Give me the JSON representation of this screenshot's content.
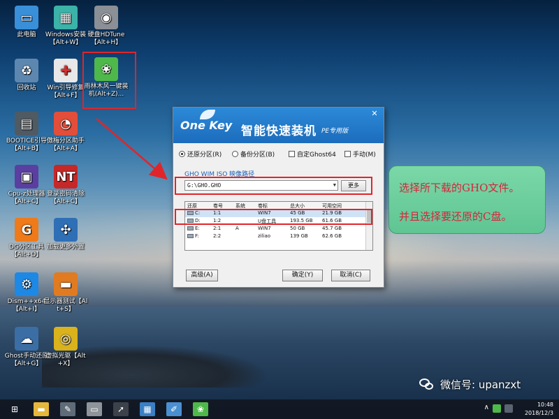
{
  "desktop_icons": [
    {
      "id": "this-pc",
      "label": "此电脑",
      "icon": "computer-icon",
      "color": "#3a8fd9",
      "glyph": "▭"
    },
    {
      "id": "windows-install",
      "label": "Windows安装【Alt+W】",
      "icon": "windows-install-icon",
      "color": "#3bb3a8",
      "glyph": "▦"
    },
    {
      "id": "hdtune",
      "label": "硬盘HDTune【Alt+H】",
      "icon": "hdd-icon",
      "color": "#8b8f96",
      "glyph": "◉"
    },
    {
      "id": "recycle-bin",
      "label": "回收站",
      "icon": "recycle-bin-icon",
      "color": "#5e87b0",
      "glyph": "♻"
    },
    {
      "id": "win-boot-repair",
      "label": "Win引导修复【Alt+F】",
      "icon": "first-aid-kit-icon",
      "color": "#e8e8e8",
      "glyph": "✚"
    },
    {
      "id": "ylmf-onekey",
      "label": "雨林木风一键装机(Alt+Z)...",
      "icon": "ghost-leaf-icon",
      "color": "#4fb84a",
      "glyph": "❀"
    },
    {
      "id": "bootice",
      "label": "BOOTICE引导【Alt+B】",
      "icon": "floppy-icon",
      "color": "#505a63",
      "glyph": "▤"
    },
    {
      "id": "partition-assistant",
      "label": "傲梅分区助手【Alt+A】",
      "icon": "pie-disk-icon",
      "color": "#e24e3a",
      "glyph": "◔"
    },
    {
      "id": "cpu-z",
      "label": "Cpu-z处理器【Alt+C】",
      "icon": "cpu-chip-icon",
      "color": "#5a3fa0",
      "glyph": "▣"
    },
    {
      "id": "password-clear",
      "label": "登录密码清除【Alt+C】",
      "icon": "nt-key-icon",
      "color": "#c62828",
      "glyph": "NT"
    },
    {
      "id": "dg-partition",
      "label": "DG分区工具【Alt+D】",
      "icon": "dg-logo-icon",
      "color": "#ef7a1a",
      "glyph": "G"
    },
    {
      "id": "load-external",
      "label": "加载更多外置",
      "icon": "expand-arrows-icon",
      "color": "#2f6fb5",
      "glyph": "✣"
    },
    {
      "id": "dism",
      "label": "Dism++x64【Alt+I】",
      "icon": "gears-icon",
      "color": "#1e88e5",
      "glyph": "⚙"
    },
    {
      "id": "display-test",
      "label": "显示器测试【Alt+S】",
      "icon": "monitor-icon",
      "color": "#e07b22",
      "glyph": "▬"
    },
    {
      "id": "ghost-manual",
      "label": "Ghost手动还原【Alt+G】",
      "icon": "ghost-icon",
      "color": "#3a6ea5",
      "glyph": "☁"
    },
    {
      "id": "virtual-drive",
      "label": "虚拟光驱【Alt+X】",
      "icon": "cd-drive-icon",
      "color": "#d9b21c",
      "glyph": "◎"
    }
  ],
  "dialog": {
    "logo_one": "One",
    "logo_key": "Key",
    "product_name": "智能快速装机",
    "edition": "PE专用版",
    "close_glyph": "✕",
    "options": {
      "restore": "还原分区(R)",
      "backup": "备份分区(B)",
      "custom_ghost": "自定Ghost64",
      "manual": "手动(M)"
    },
    "selected_option": "restore",
    "path_label": "GHO WIM ISO 映像路径",
    "path_value": "G:\\GHO.GHO",
    "more_button": "更多",
    "table": {
      "headers": [
        "还原",
        "卷号",
        "系统",
        "卷标",
        "总大小",
        "可用空间"
      ],
      "rows": [
        {
          "drive": "C:",
          "vol": "1:1",
          "sys": "",
          "label": "WIN7",
          "total": "45 GB",
          "free": "21.9 GB",
          "selected": true
        },
        {
          "drive": "D:",
          "vol": "1:2",
          "sys": "",
          "label": "U盘工具",
          "total": "193.5 GB",
          "free": "61.6 GB",
          "selected": false
        },
        {
          "drive": "E:",
          "vol": "2:1",
          "sys": "A",
          "label": "WIN7",
          "total": "50 GB",
          "free": "45.7 GB",
          "selected": false
        },
        {
          "drive": "F:",
          "vol": "2:2",
          "sys": "",
          "label": "ziliao",
          "total": "139 GB",
          "free": "62.6 GB",
          "selected": false
        }
      ]
    },
    "buttons": {
      "advanced": "高级(A)",
      "ok": "确定(Y)",
      "cancel": "取消(C)"
    }
  },
  "callout": {
    "line1": "选择所下载的GHO文件。",
    "line2": "并且选择要还原的C盘。"
  },
  "watermark": {
    "text": "微信号: upanzxt"
  },
  "taskbar": {
    "time": "10:48",
    "date": "2018/12/3",
    "chevron": "∧"
  },
  "colors": {
    "highlight_red": "#e0252a",
    "dialog_blue": "#1c6cbc",
    "callout_green": "#6ccf9c",
    "callout_text": "#d4253a"
  }
}
